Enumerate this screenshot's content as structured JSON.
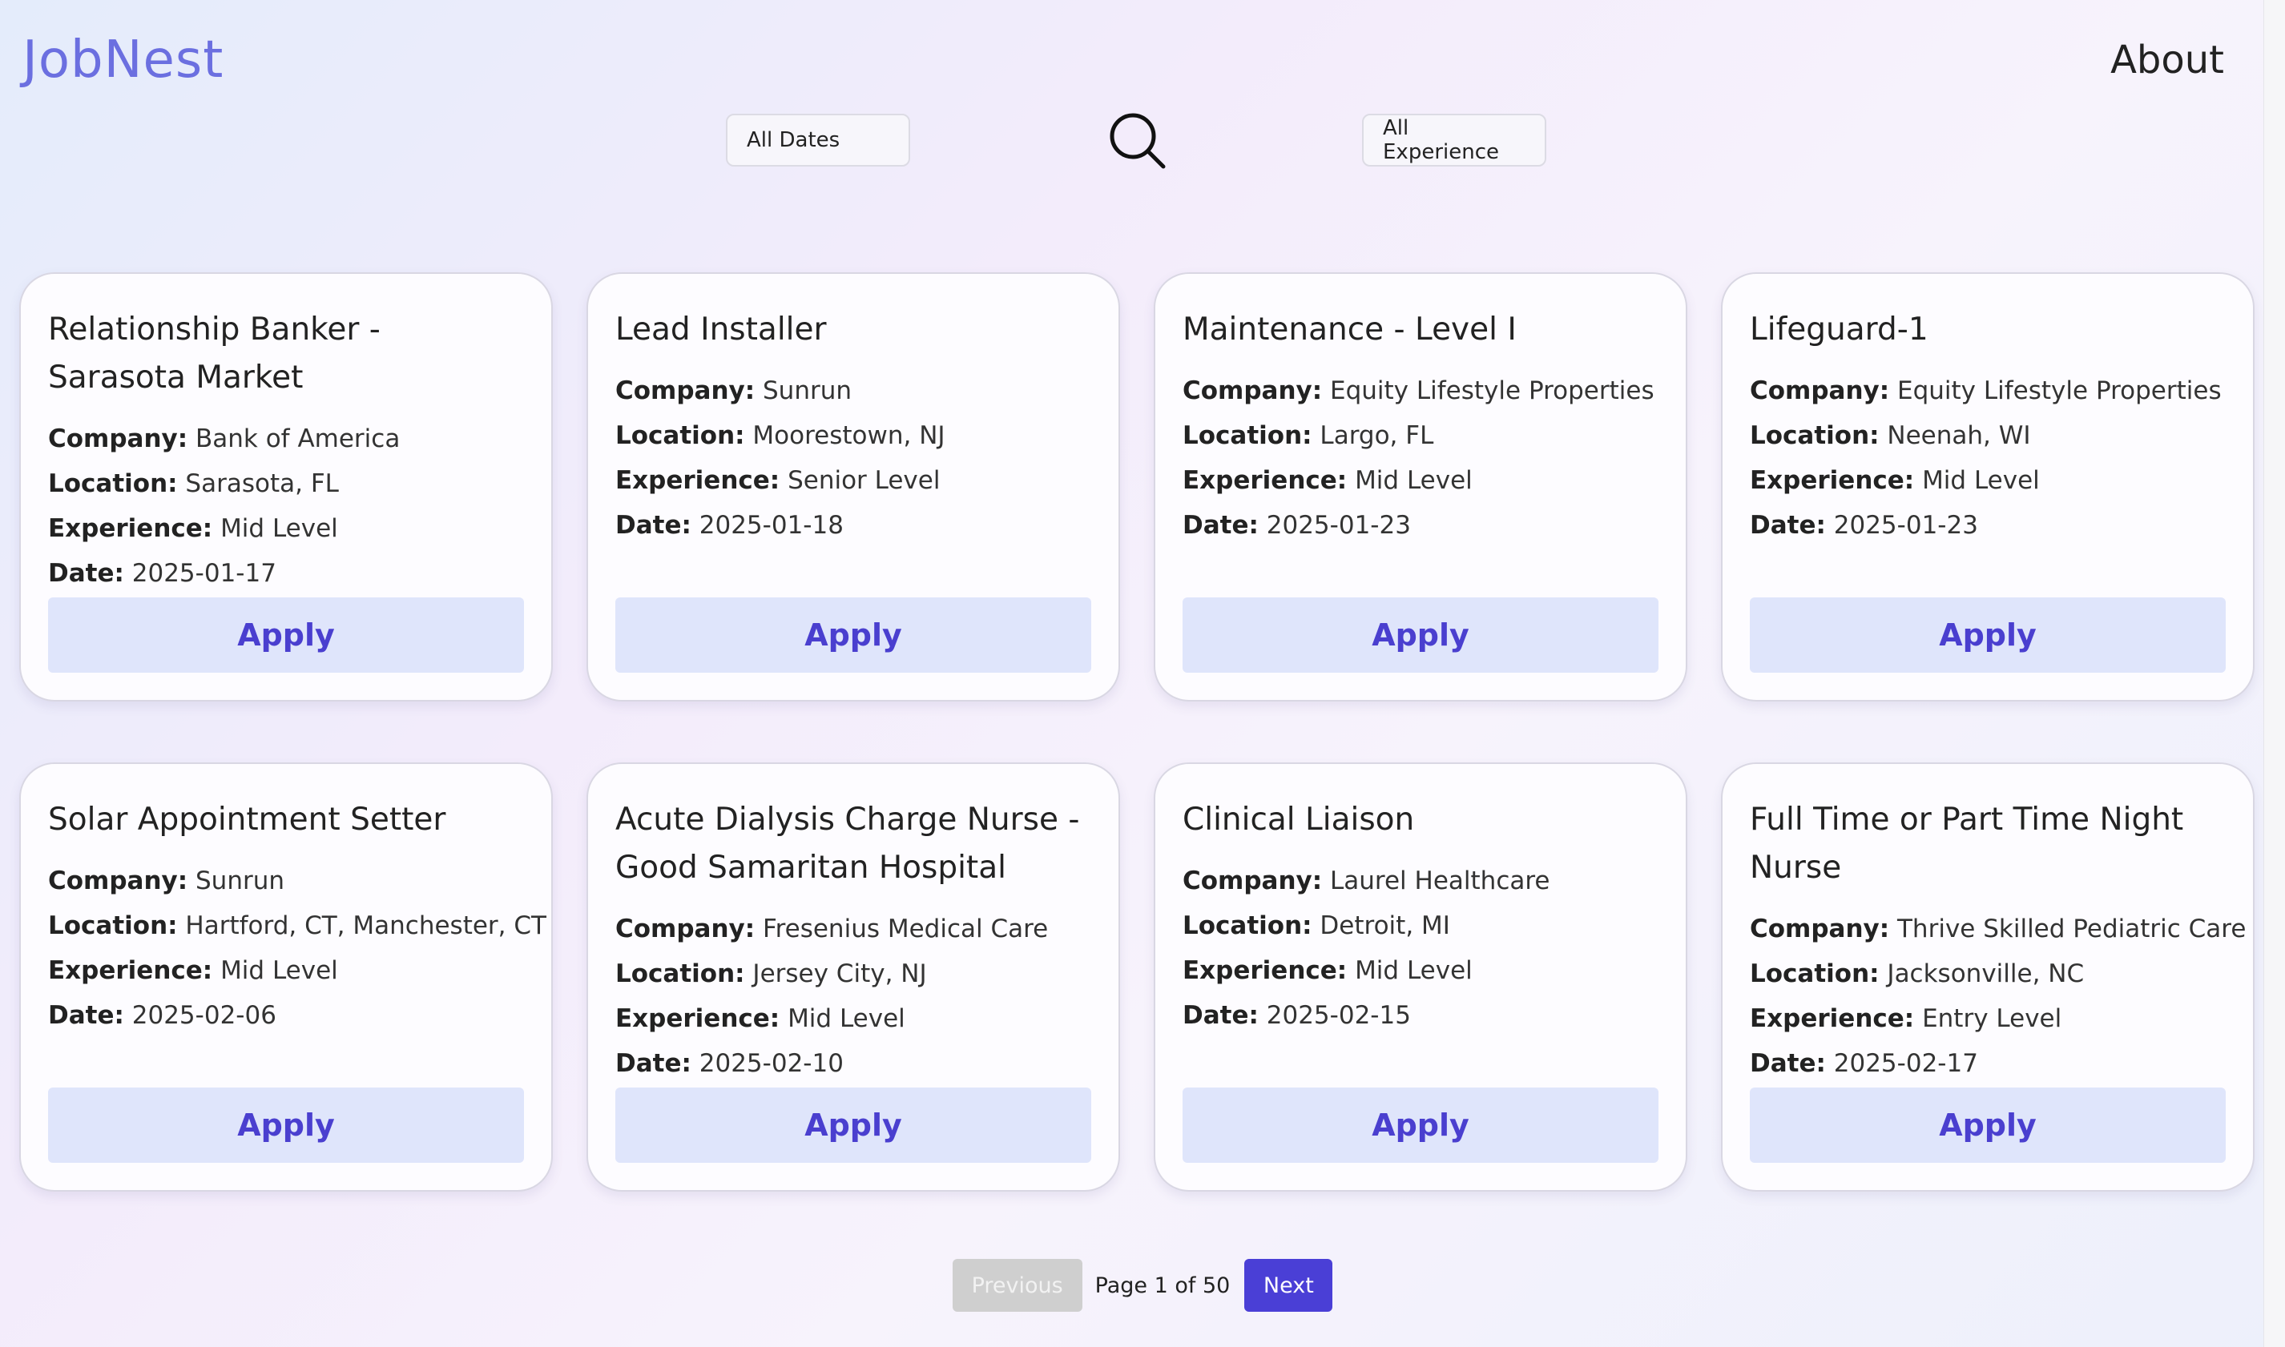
{
  "header": {
    "logo": "JobNest",
    "about_label": "About"
  },
  "filters": {
    "dates": {
      "selected": "All Dates"
    },
    "experience": {
      "selected": "All Experience"
    },
    "search_icon": "search-icon"
  },
  "labels": {
    "company": "Company:",
    "location": "Location:",
    "experience": "Experience:",
    "date": "Date:"
  },
  "jobs": [
    {
      "title": "Relationship Banker - Sarasota Market",
      "company": "Bank of America",
      "location": "Sarasota, FL",
      "experience": "Mid Level",
      "date": "2025-01-17",
      "apply_label": "Apply"
    },
    {
      "title": "Lead Installer",
      "company": "Sunrun",
      "location": "Moorestown, NJ",
      "experience": "Senior Level",
      "date": "2025-01-18",
      "apply_label": "Apply"
    },
    {
      "title": "Maintenance - Level I",
      "company": "Equity Lifestyle Properties",
      "location": "Largo, FL",
      "experience": "Mid Level",
      "date": "2025-01-23",
      "apply_label": "Apply"
    },
    {
      "title": "Lifeguard-1",
      "company": "Equity Lifestyle Properties",
      "location": "Neenah, WI",
      "experience": "Mid Level",
      "date": "2025-01-23",
      "apply_label": "Apply"
    },
    {
      "title": "Solar Appointment Setter",
      "company": "Sunrun",
      "location": "Hartford, CT, Manchester, CT",
      "experience": "Mid Level",
      "date": "2025-02-06",
      "apply_label": "Apply"
    },
    {
      "title": "Acute Dialysis Charge Nurse - Good Samaritan Hospital",
      "company": "Fresenius Medical Care",
      "location": "Jersey City, NJ",
      "experience": "Mid Level",
      "date": "2025-02-10",
      "apply_label": "Apply"
    },
    {
      "title": "Clinical Liaison",
      "company": "Laurel Healthcare",
      "location": "Detroit, MI",
      "experience": "Mid Level",
      "date": "2025-02-15",
      "apply_label": "Apply"
    },
    {
      "title": "Full Time or Part Time Night Nurse",
      "company": "Thrive Skilled Pediatric Care",
      "location": "Jacksonville, NC",
      "experience": "Entry Level",
      "date": "2025-02-17",
      "apply_label": "Apply"
    }
  ],
  "pagination": {
    "previous_label": "Previous",
    "page_info": "Page 1 of 50",
    "next_label": "Next"
  },
  "colors": {
    "brand": "#6b6fe0",
    "apply_bg": "#dfe5fb",
    "apply_text": "#4a3fcf",
    "next_bg": "#4a3fd6",
    "previous_disabled_bg": "#cfcfcf"
  }
}
